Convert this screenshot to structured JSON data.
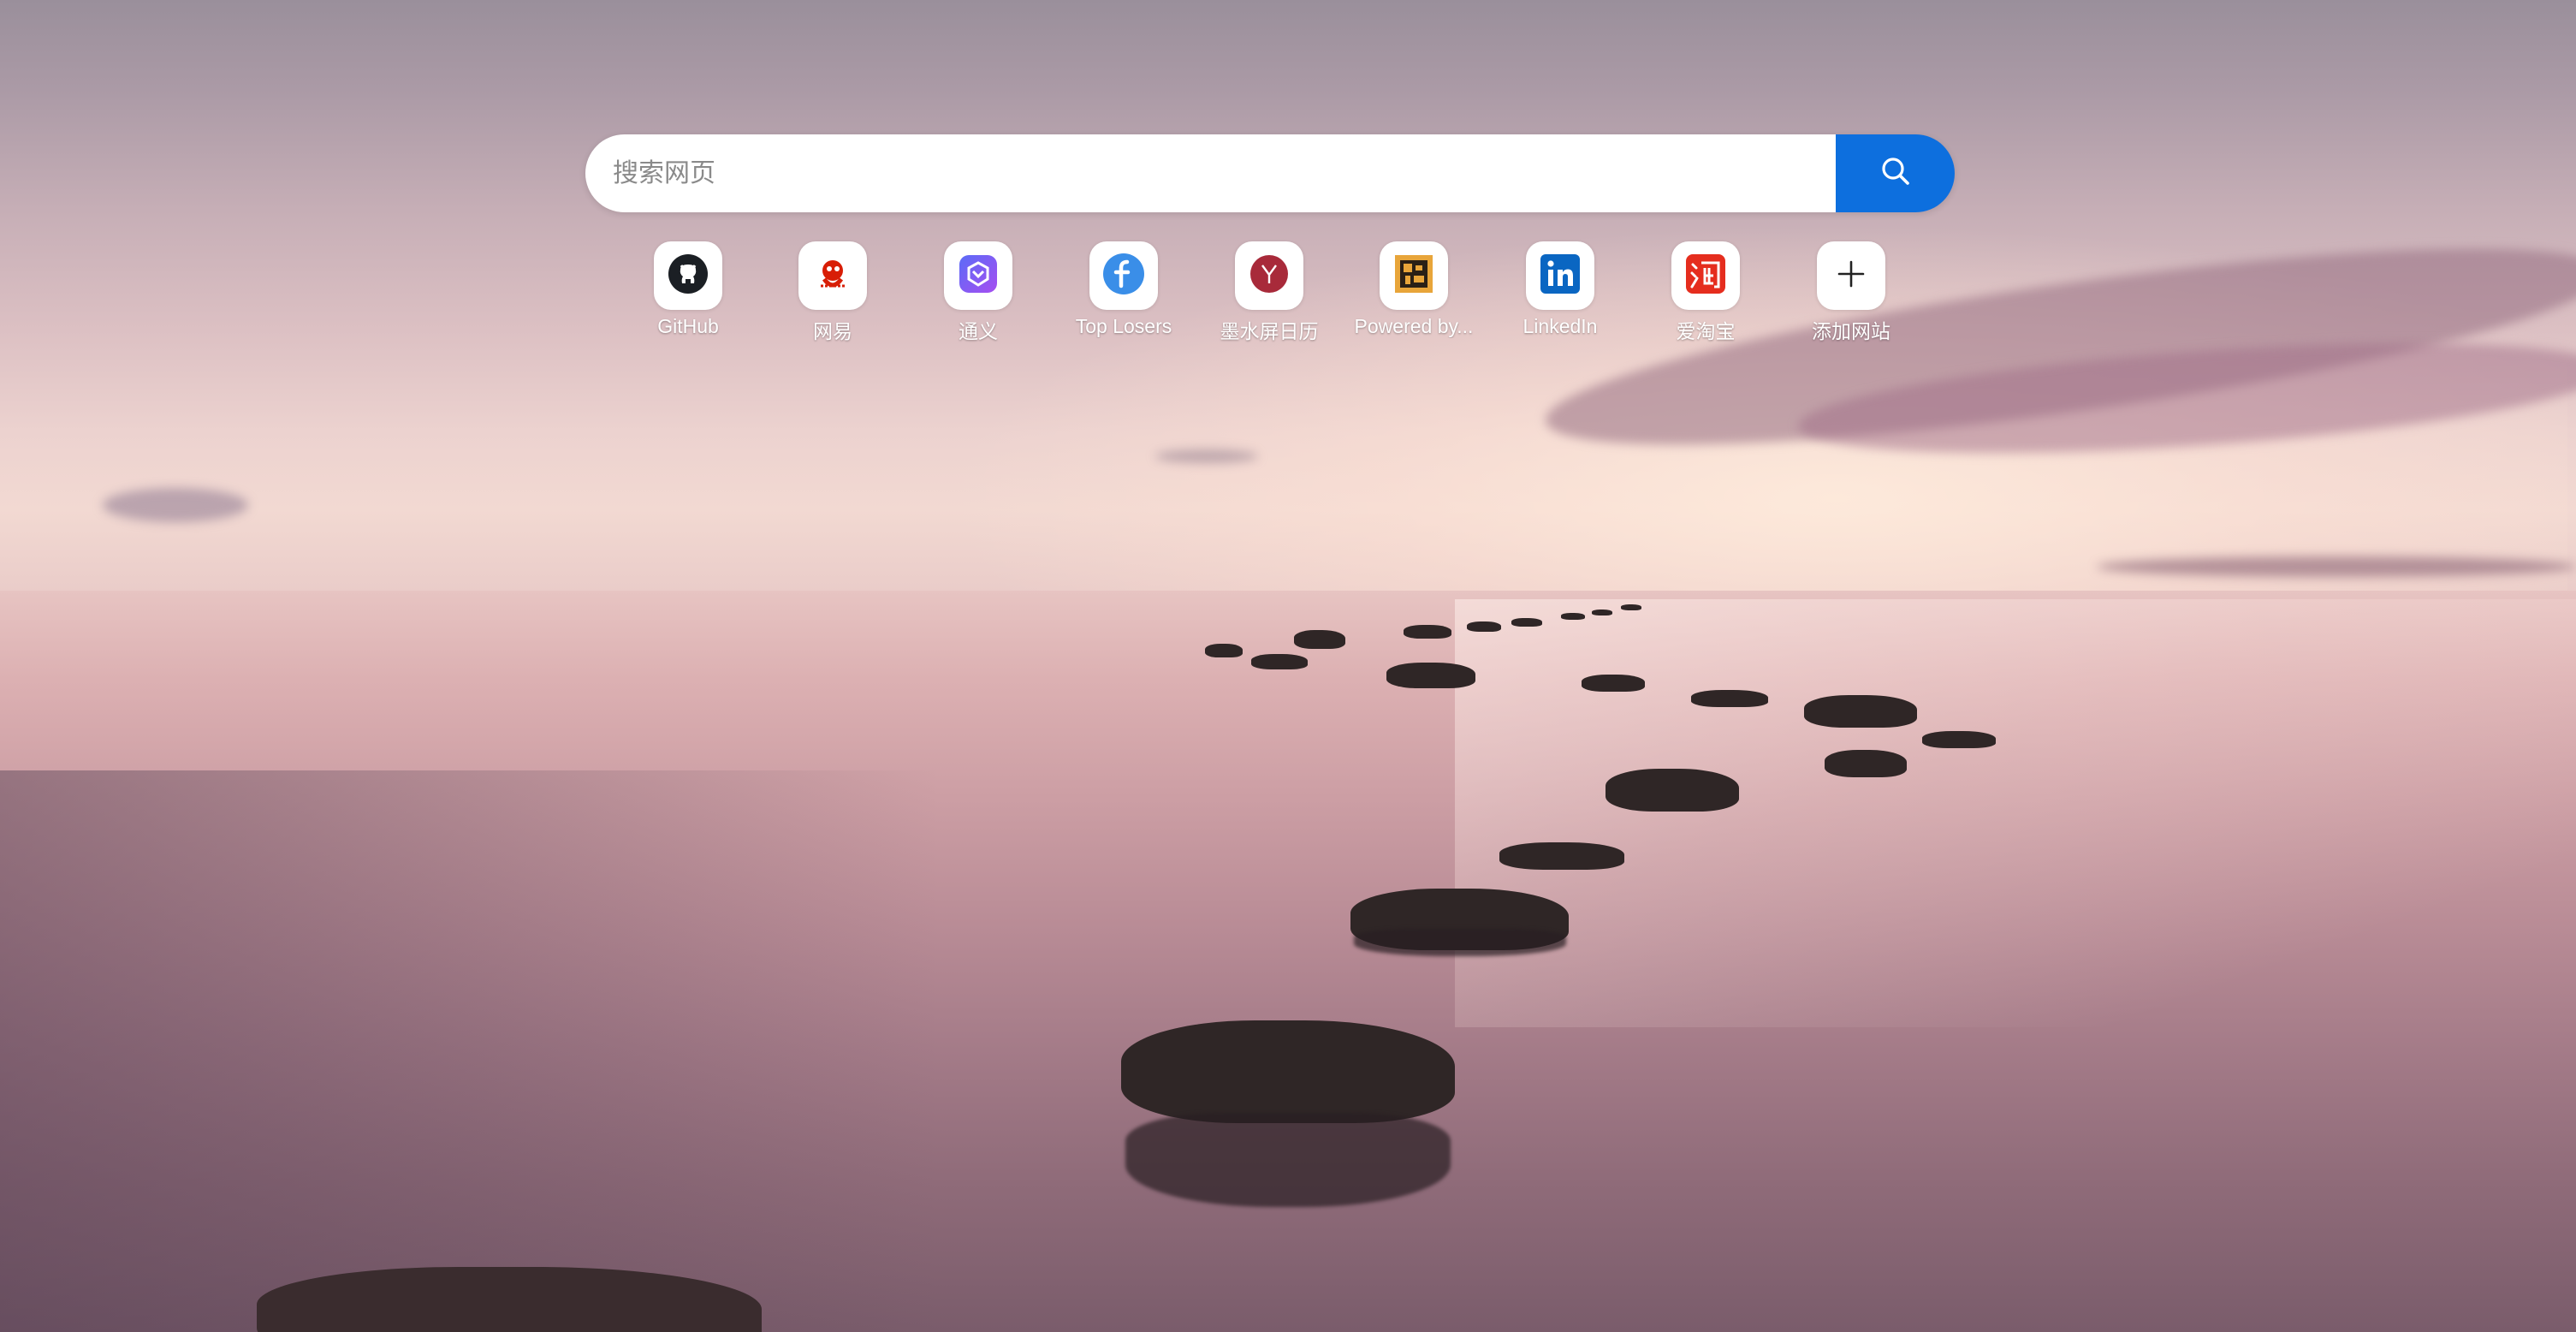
{
  "search": {
    "placeholder": "搜索网页",
    "button_icon": "search-icon",
    "button_color": "#0d6fde"
  },
  "shortcuts": [
    {
      "label": "GitHub",
      "icon": "github-icon"
    },
    {
      "label": "网易",
      "icon": "netease-icon"
    },
    {
      "label": "通义",
      "icon": "tongyi-icon"
    },
    {
      "label": "Top Losers",
      "icon": "top-losers-icon"
    },
    {
      "label": "墨水屏日历",
      "icon": "eink-calendar-icon"
    },
    {
      "label": "Powered by...",
      "icon": "powered-by-icon"
    },
    {
      "label": "LinkedIn",
      "icon": "linkedin-icon"
    },
    {
      "label": "爱淘宝",
      "icon": "taobao-icon"
    },
    {
      "label": "添加网站",
      "icon": "plus-icon"
    }
  ],
  "colors": {
    "linkedin": "#0a66c2",
    "taobao": "#e52d1e",
    "tongyi": "#6b5cf5",
    "top_losers": "#3a8ee8",
    "eink_calendar": "#a82a3a"
  }
}
